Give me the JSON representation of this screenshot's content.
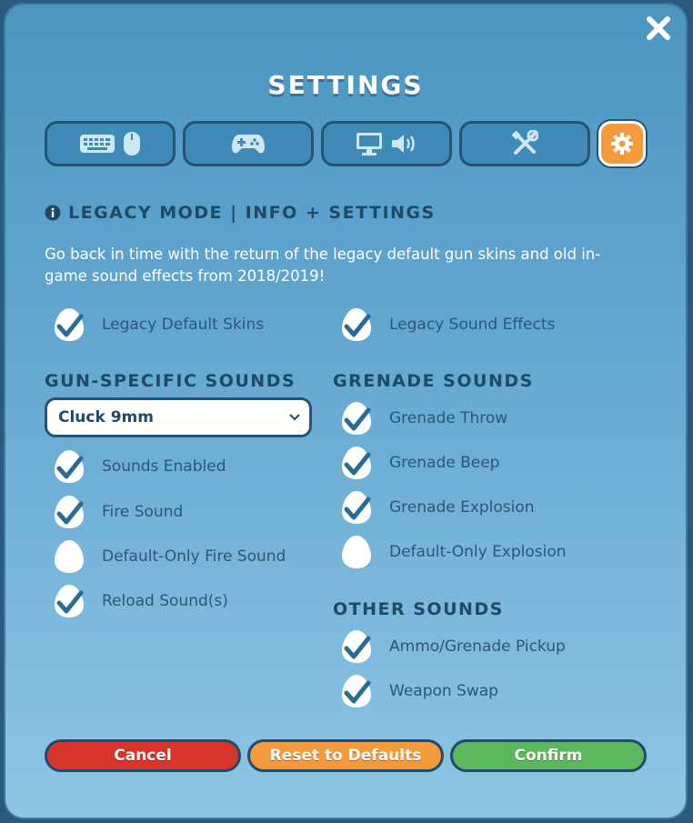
{
  "title": "SETTINGS",
  "close_icon": "close-icon",
  "tabs": [
    {
      "name": "keyboard-mouse",
      "icons": [
        "keyboard-icon",
        "mouse-icon"
      ]
    },
    {
      "name": "controller",
      "icons": [
        "gamepad-icon"
      ]
    },
    {
      "name": "display-audio",
      "icons": [
        "monitor-icon",
        "speaker-icon"
      ]
    },
    {
      "name": "tools",
      "icons": [
        "tools-icon"
      ]
    },
    {
      "name": "misc",
      "icons": [
        "gear-icon"
      ],
      "active": true
    }
  ],
  "legacy": {
    "heading": "LEGACY MODE | INFO + SETTINGS",
    "intro": "Go back in time with the return of the legacy default gun skins and old in-game sound effects from 2018/2019!",
    "skins_label": "Legacy Default Skins",
    "skins_checked": true,
    "sfx_label": "Legacy Sound Effects",
    "sfx_checked": true
  },
  "gun_sounds": {
    "heading": "GUN-SPECIFIC SOUNDS",
    "selected_gun": "Cluck 9mm",
    "options": [
      {
        "label": "Sounds Enabled",
        "checked": true
      },
      {
        "label": "Fire Sound",
        "checked": true
      },
      {
        "label": "Default-Only Fire Sound",
        "checked": false
      },
      {
        "label": "Reload Sound(s)",
        "checked": true
      }
    ]
  },
  "grenade_sounds": {
    "heading": "GRENADE SOUNDS",
    "options": [
      {
        "label": "Grenade Throw",
        "checked": true
      },
      {
        "label": "Grenade Beep",
        "checked": true
      },
      {
        "label": "Grenade Explosion",
        "checked": true
      },
      {
        "label": "Default-Only Explosion",
        "checked": false
      }
    ]
  },
  "other_sounds": {
    "heading": "OTHER SOUNDS",
    "options": [
      {
        "label": "Ammo/Grenade Pickup",
        "checked": true
      },
      {
        "label": "Weapon Swap",
        "checked": true
      }
    ]
  },
  "buttons": {
    "cancel": "Cancel",
    "reset": "Reset to Defaults",
    "confirm": "Confirm"
  },
  "colors": {
    "cancel": "#d9342b",
    "reset": "#f29a3c",
    "confirm": "#5cb85c",
    "active_tab": "#f29a3c",
    "heading": "#1d4a66"
  }
}
